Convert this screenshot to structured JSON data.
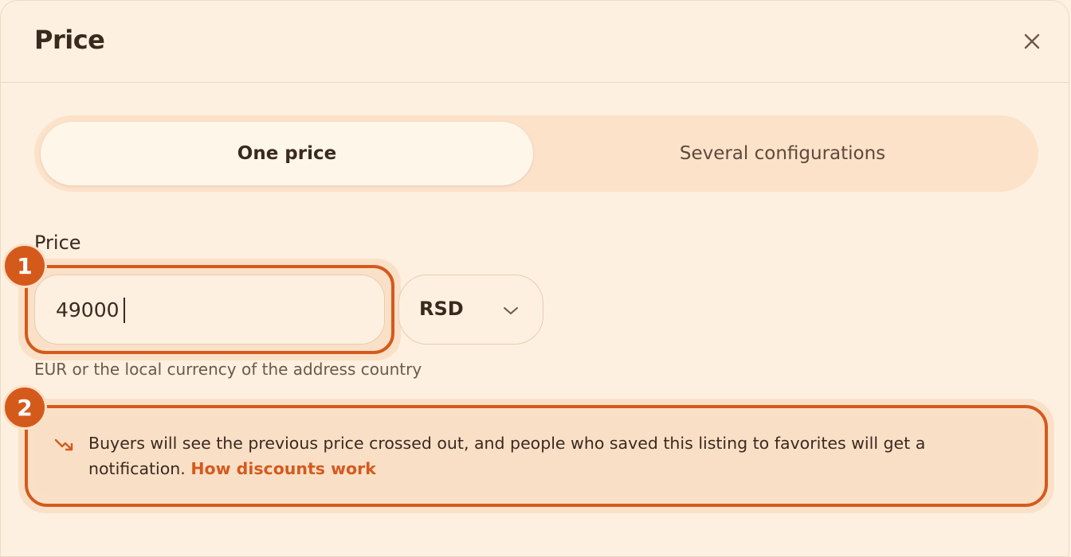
{
  "dialog": {
    "title": "Price"
  },
  "segment": {
    "options": [
      {
        "label": "One price",
        "selected": true
      },
      {
        "label": "Several configurations",
        "selected": false
      }
    ]
  },
  "price": {
    "label": "Price",
    "value": "49000",
    "currency": "RSD",
    "hint": "EUR or the local currency of the address country"
  },
  "notice": {
    "text": "Buyers will see the previous price crossed out, and people who saved this listing to favorites will get a notification. ",
    "link": "How discounts work"
  },
  "badges": [
    "1",
    "2"
  ],
  "colors": {
    "accent": "#d45a1c",
    "background": "#fdf0e0",
    "segment_bg": "#fbe2c9"
  }
}
